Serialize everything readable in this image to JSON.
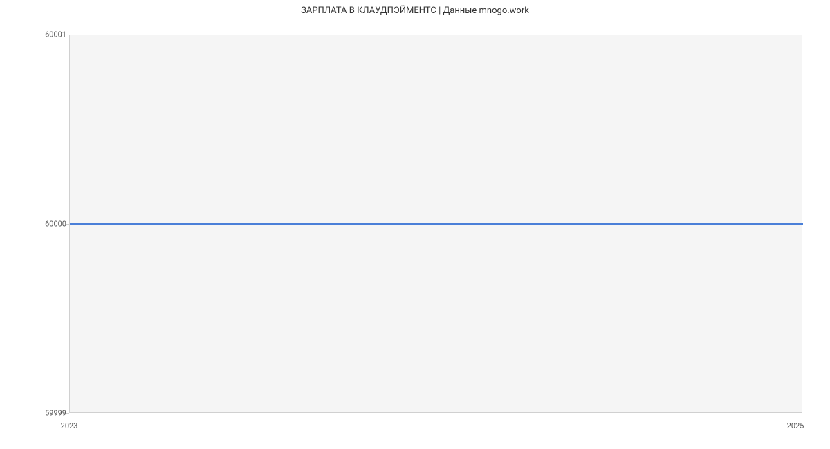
{
  "chart_data": {
    "type": "line",
    "title": "ЗАРПЛАТА В КЛАУДПЭЙМЕНТС | Данные mnogo.work",
    "xlabel": "",
    "ylabel": "",
    "x": [
      2023,
      2025
    ],
    "values": [
      60000,
      60000
    ],
    "xlim": [
      2023,
      2025
    ],
    "ylim": [
      59999,
      60001
    ],
    "y_ticks": [
      59999,
      60000,
      60001
    ],
    "x_ticks": [
      2023,
      2025
    ]
  }
}
